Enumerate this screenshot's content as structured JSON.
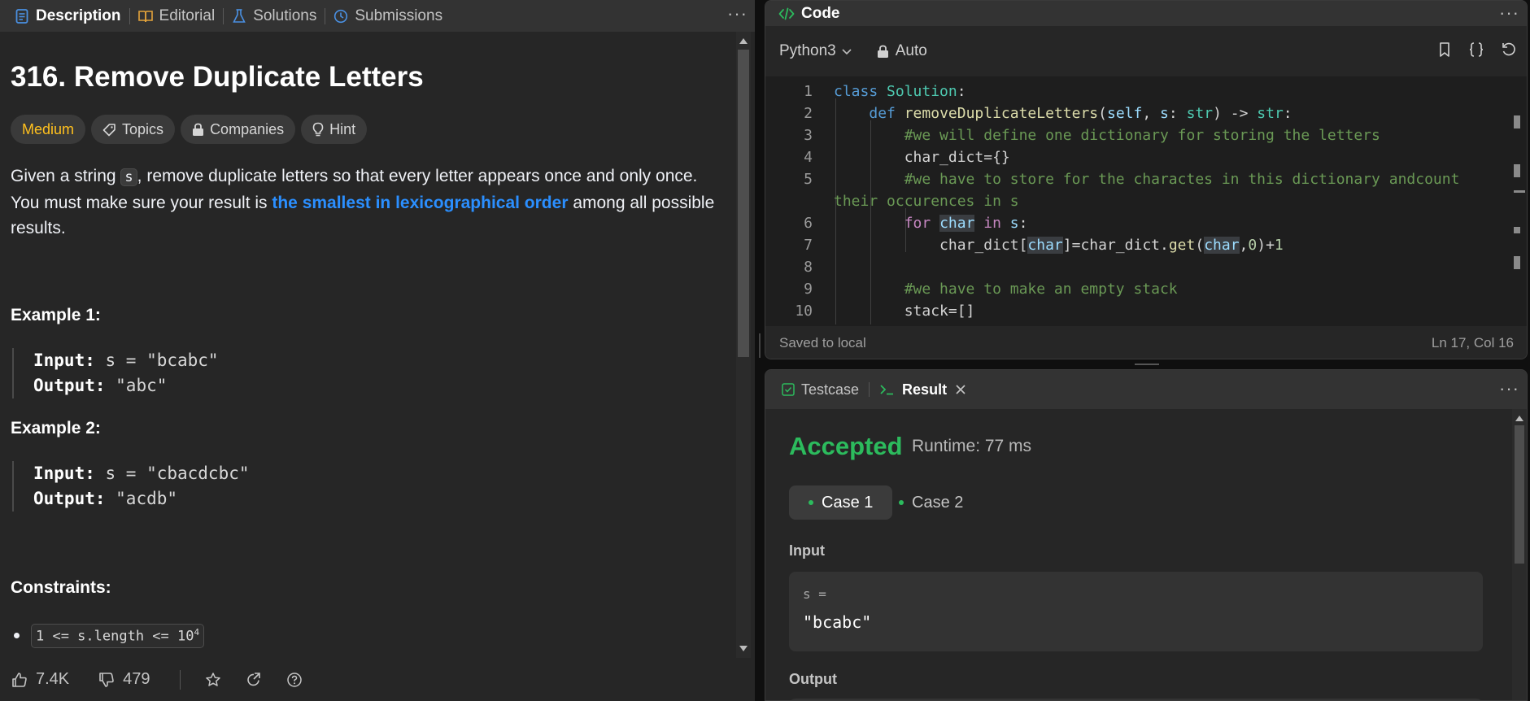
{
  "left_tabs": [
    {
      "label": "Description",
      "active": true
    },
    {
      "label": "Editorial",
      "active": false
    },
    {
      "label": "Solutions",
      "active": false
    },
    {
      "label": "Submissions",
      "active": false
    }
  ],
  "problem": {
    "title": "316. Remove Duplicate Letters",
    "difficulty": "Medium",
    "badges": [
      "Topics",
      "Companies",
      "Hint"
    ],
    "desc_pre": "Given a string ",
    "desc_code": "s",
    "desc_mid": ", remove duplicate letters so that every letter appears once and only once. You must make sure your result is ",
    "desc_highlight": "the smallest in lexicographical order",
    "desc_post": " among all possible results.",
    "examples": [
      {
        "title": "Example 1:",
        "input_label": "Input:",
        "input": " s = \"bcabc\"",
        "output_label": "Output:",
        "output": " \"abc\""
      },
      {
        "title": "Example 2:",
        "input_label": "Input:",
        "input": " s = \"cbacdcbc\"",
        "output_label": "Output:",
        "output": " \"acdb\""
      }
    ],
    "constraints_title": "Constraints:",
    "constraint_1": "1 <= s.length <= 10",
    "constraint_1_sup": "4"
  },
  "footer": {
    "likes": "7.4K",
    "dislikes": "479"
  },
  "code_panel": {
    "title": "Code",
    "language": "Python3",
    "mode": "Auto",
    "status_left": "Saved to local",
    "status_right": "Ln 17, Col 16"
  },
  "code_lines": [
    "1",
    "2",
    "3",
    "4",
    "5",
    "6",
    "7",
    "8",
    "9",
    "10"
  ],
  "result_panel": {
    "tab_testcase": "Testcase",
    "tab_result": "Result",
    "status": "Accepted",
    "runtime": "Runtime: 77 ms",
    "case_1": "Case 1",
    "case_2": "Case 2",
    "input_label": "Input",
    "input_var": "s =",
    "input_value": "\"bcabc\"",
    "output_label": "Output"
  },
  "colors": {
    "accent_green": "#2cbb5d",
    "medium": "#ffc01e",
    "link_blue": "#2b8fff"
  }
}
